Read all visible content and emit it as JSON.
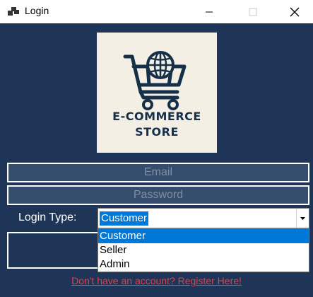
{
  "window": {
    "title": "Login",
    "icons": [
      "app-icon",
      "minimize-icon",
      "maximize-icon",
      "close-icon"
    ]
  },
  "logo": {
    "line1": "E-COMMERCE",
    "line2": "STORE",
    "icon": "shopping-cart-globe-icon"
  },
  "form": {
    "email_placeholder": "Email",
    "password_placeholder": "Password",
    "login_type_label": "Login Type:",
    "login_type_value": "Customer",
    "login_type_options": [
      "Customer",
      "Seller",
      "Admin"
    ],
    "register_link": "Don't have an account? Register Here!"
  },
  "colors": {
    "background": "#1f3557",
    "field_bg": "#354e6d",
    "selection": "#0078d7",
    "link": "#e0414b",
    "logo_bg": "#f4efe4"
  }
}
